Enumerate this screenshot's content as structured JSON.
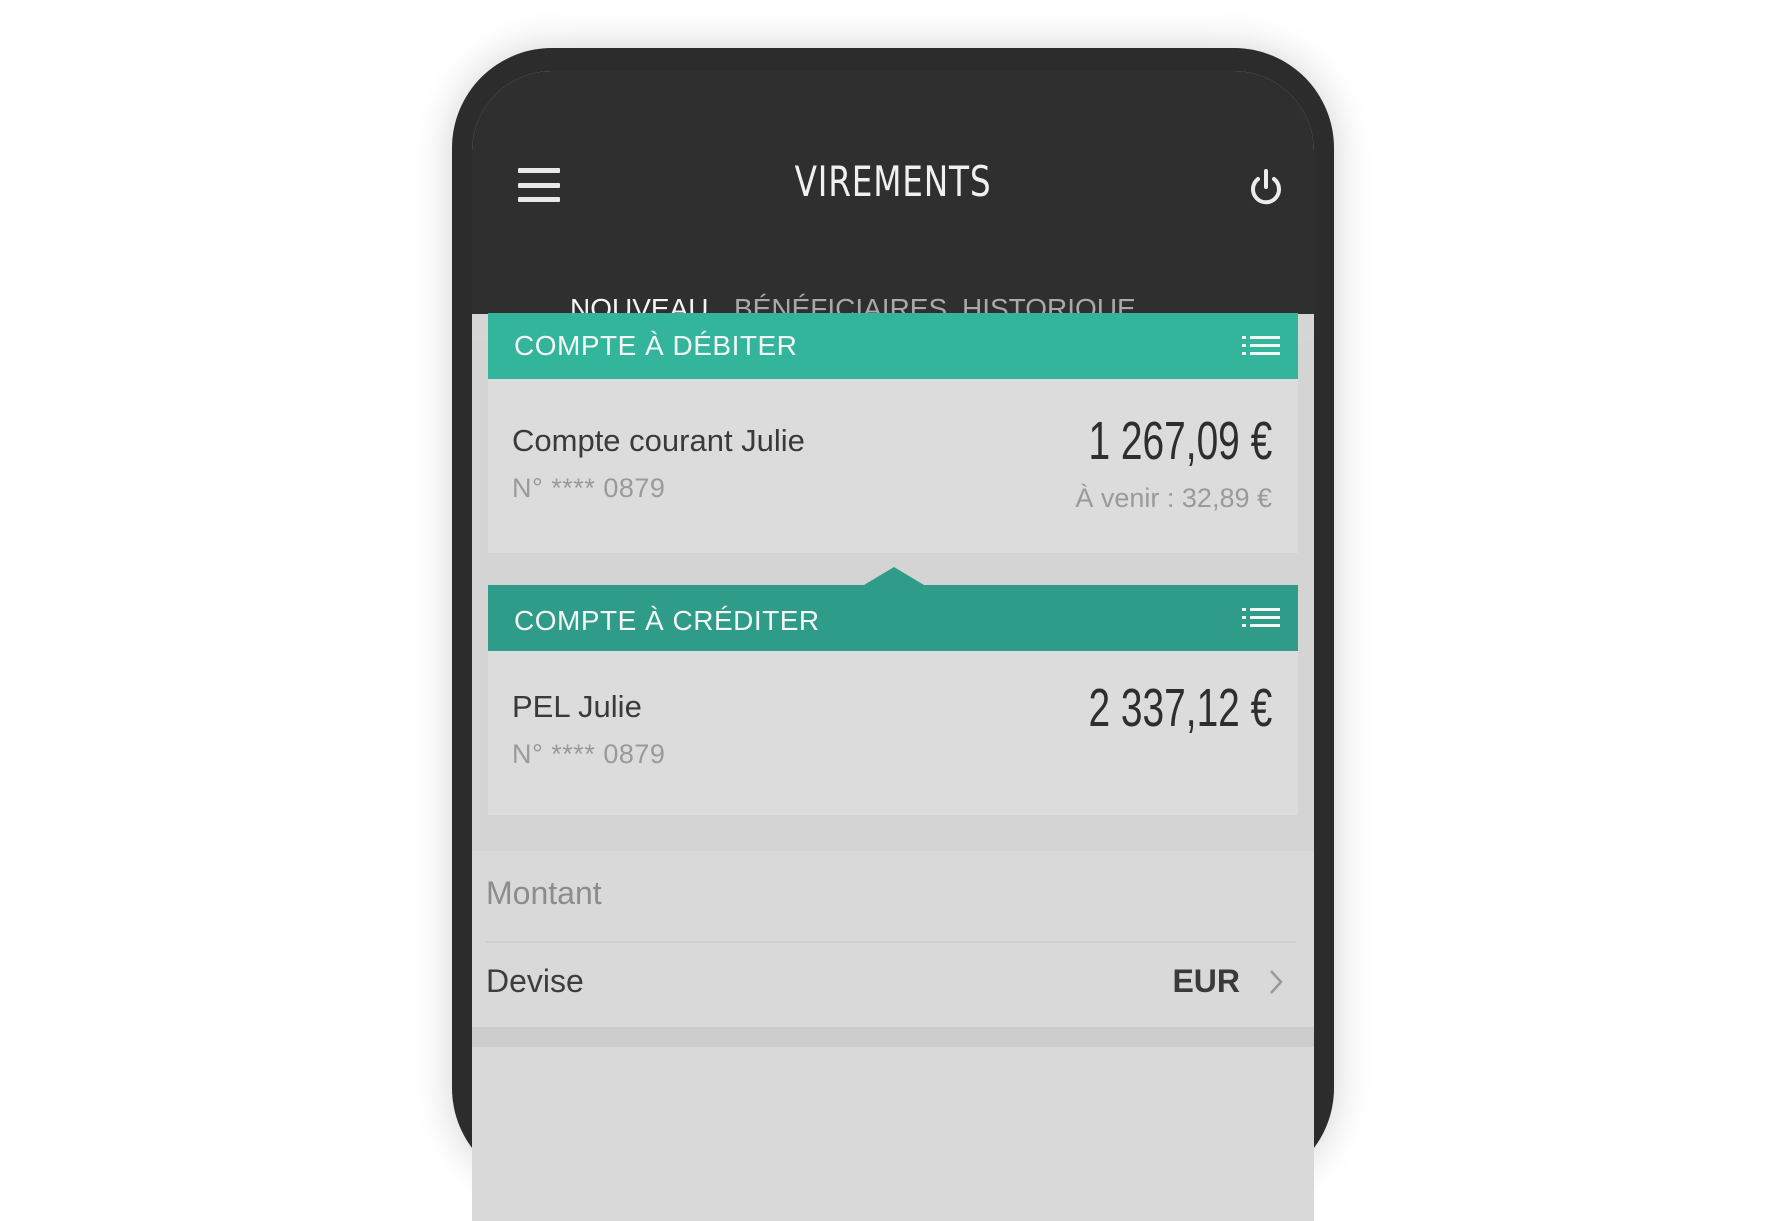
{
  "header": {
    "title": "VIREMENTS",
    "menu_icon": "hamburger-menu-icon",
    "power_icon": "power-icon"
  },
  "tabs": [
    {
      "label": "NOUVEAU",
      "active": true
    },
    {
      "label": "BÉNÉFICIAIRES",
      "active": false
    },
    {
      "label": "HISTORIQUE",
      "active": false
    }
  ],
  "debit": {
    "header": "COMPTE À DÉBITER",
    "account_name": "Compte courant Julie",
    "account_number": "N° **** 0879",
    "balance": "1 267,09 €",
    "upcoming": "À venir : 32,89 €"
  },
  "credit": {
    "header": "COMPTE À CRÉDITER",
    "account_name": "PEL Julie",
    "account_number": "N° **** 0879",
    "balance": "2 337,12 €"
  },
  "form": {
    "amount_placeholder": "Montant",
    "currency_label": "Devise",
    "currency_value": "EUR"
  },
  "colors": {
    "accent": "#33b59c",
    "accent_dark": "#2f9c8a",
    "topbar": "#2f2f2f"
  }
}
